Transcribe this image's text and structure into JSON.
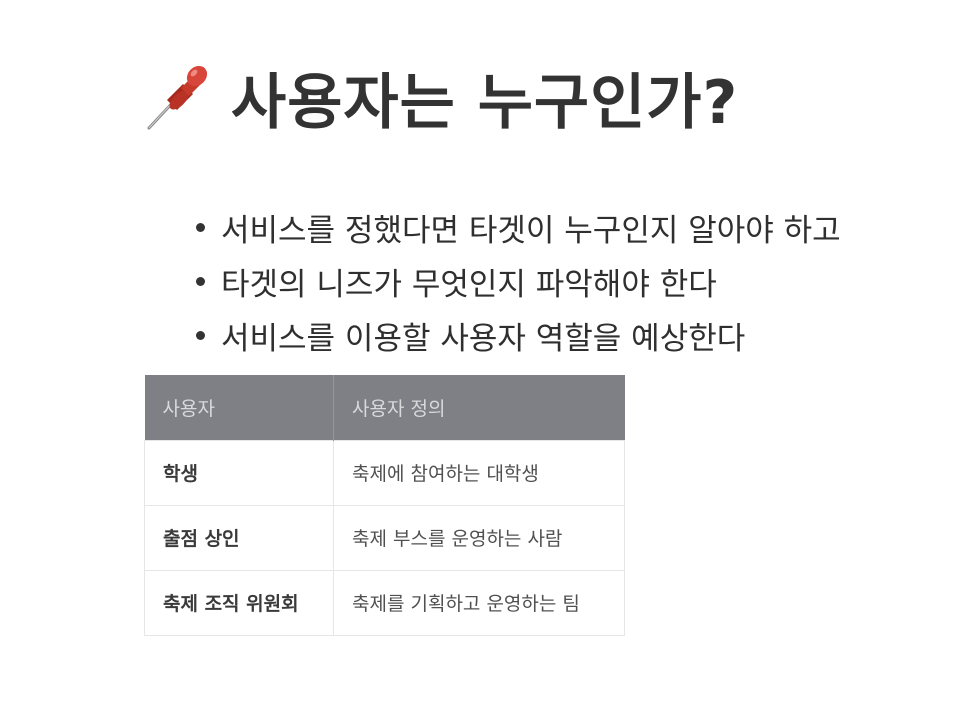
{
  "title": {
    "icon": "pushpin-icon",
    "text": "사용자는 누구인가?"
  },
  "bullets": [
    "서비스를 정했다면 타겟이 누구인지 알아야 하고",
    "타겟의 니즈가 무엇인지 파악해야 한다",
    "서비스를 이용할 사용자 역할을 예상한다"
  ],
  "table": {
    "headers": [
      "사용자",
      "사용자 정의"
    ],
    "rows": [
      [
        "학생",
        "축제에 참여하는 대학생"
      ],
      [
        "출점 상인",
        "축제 부스를 운영하는 사람"
      ],
      [
        "축제 조직 위원회",
        "축제를 기획하고 운영하는 팀"
      ]
    ]
  },
  "colors": {
    "header_bg": "#7f8085",
    "header_text": "#d9d9dc",
    "pin_red": "#c0392b"
  }
}
